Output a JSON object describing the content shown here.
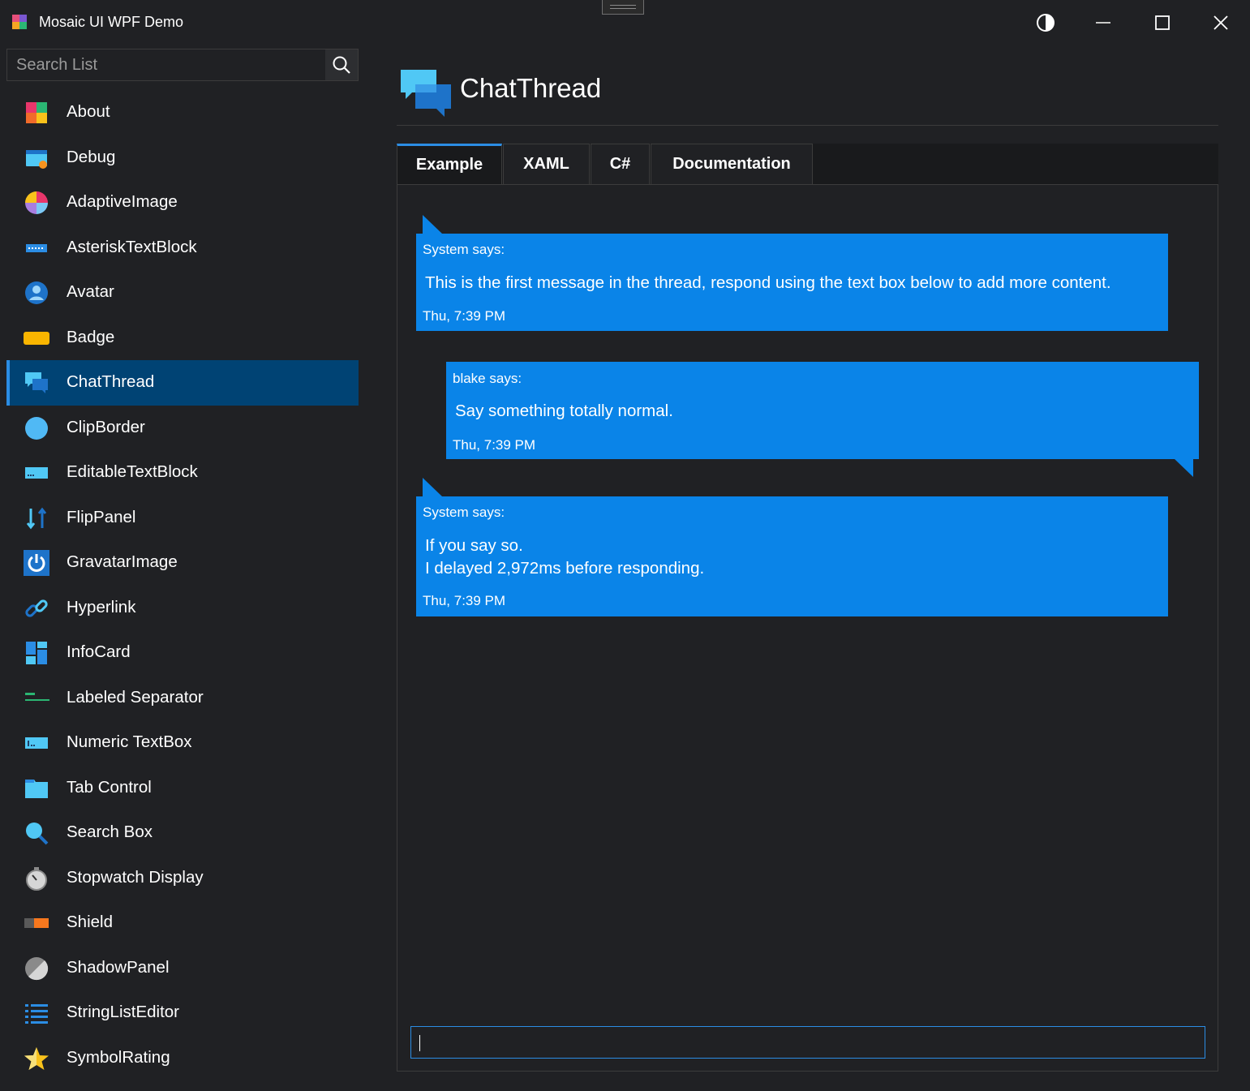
{
  "window": {
    "title": "Mosaic UI WPF Demo",
    "theme_toggle_icon": "contrast-icon",
    "minimize_icon": "minimize-icon",
    "maximize_icon": "maximize-icon",
    "close_icon": "close-icon"
  },
  "sidebar": {
    "search_placeholder": "Search List",
    "search_icon": "search-icon",
    "selected_index": 6,
    "items": [
      {
        "label": "About",
        "icon": "mosaic-icon"
      },
      {
        "label": "Debug",
        "icon": "debug-window-icon"
      },
      {
        "label": "AdaptiveImage",
        "icon": "color-wheel-icon"
      },
      {
        "label": "AsteriskTextBlock",
        "icon": "password-field-icon"
      },
      {
        "label": "Avatar",
        "icon": "avatar-icon"
      },
      {
        "label": "Badge",
        "icon": "badge-icon"
      },
      {
        "label": "ChatThread",
        "icon": "chat-bubbles-icon"
      },
      {
        "label": "ClipBorder",
        "icon": "circle-icon"
      },
      {
        "label": "EditableTextBlock",
        "icon": "text-field-icon"
      },
      {
        "label": "FlipPanel",
        "icon": "flip-arrows-icon"
      },
      {
        "label": "GravatarImage",
        "icon": "power-icon"
      },
      {
        "label": "Hyperlink",
        "icon": "link-icon"
      },
      {
        "label": "InfoCard",
        "icon": "dashboard-icon"
      },
      {
        "label": "Labeled Separator",
        "icon": "separator-icon"
      },
      {
        "label": "Numeric TextBox",
        "icon": "numeric-field-icon"
      },
      {
        "label": "Tab Control",
        "icon": "folder-tab-icon"
      },
      {
        "label": "Search Box",
        "icon": "magnifier-icon"
      },
      {
        "label": "Stopwatch Display",
        "icon": "stopwatch-icon"
      },
      {
        "label": "Shield",
        "icon": "shield-badge-icon"
      },
      {
        "label": "ShadowPanel",
        "icon": "shadow-circle-icon"
      },
      {
        "label": "StringListEditor",
        "icon": "list-icon"
      },
      {
        "label": "SymbolRating",
        "icon": "star-icon"
      }
    ]
  },
  "main": {
    "title": "ChatThread",
    "title_icon": "chat-bubbles-icon",
    "tabs": [
      {
        "label": "Example",
        "active": true
      },
      {
        "label": "XAML",
        "active": false
      },
      {
        "label": "C#",
        "active": false
      },
      {
        "label": "Documentation",
        "active": false
      }
    ],
    "messages": [
      {
        "from": "System says:",
        "lines": [
          "This is the first message in the thread, respond using the text box below to add more content."
        ],
        "time": "Thu, 7:39 PM",
        "side": "left"
      },
      {
        "from": "blake says:",
        "lines": [
          "Say something totally normal."
        ],
        "time": "Thu, 7:39 PM",
        "side": "right"
      },
      {
        "from": "System says:",
        "lines": [
          "If you say so.",
          "I delayed 2,972ms before responding."
        ],
        "time": "Thu, 7:39 PM",
        "side": "left"
      }
    ],
    "reply_value": ""
  },
  "colors": {
    "background": "#202124",
    "accent": "#2b8de4",
    "selected_item": "#004374",
    "bubble": "#0a84e8"
  }
}
